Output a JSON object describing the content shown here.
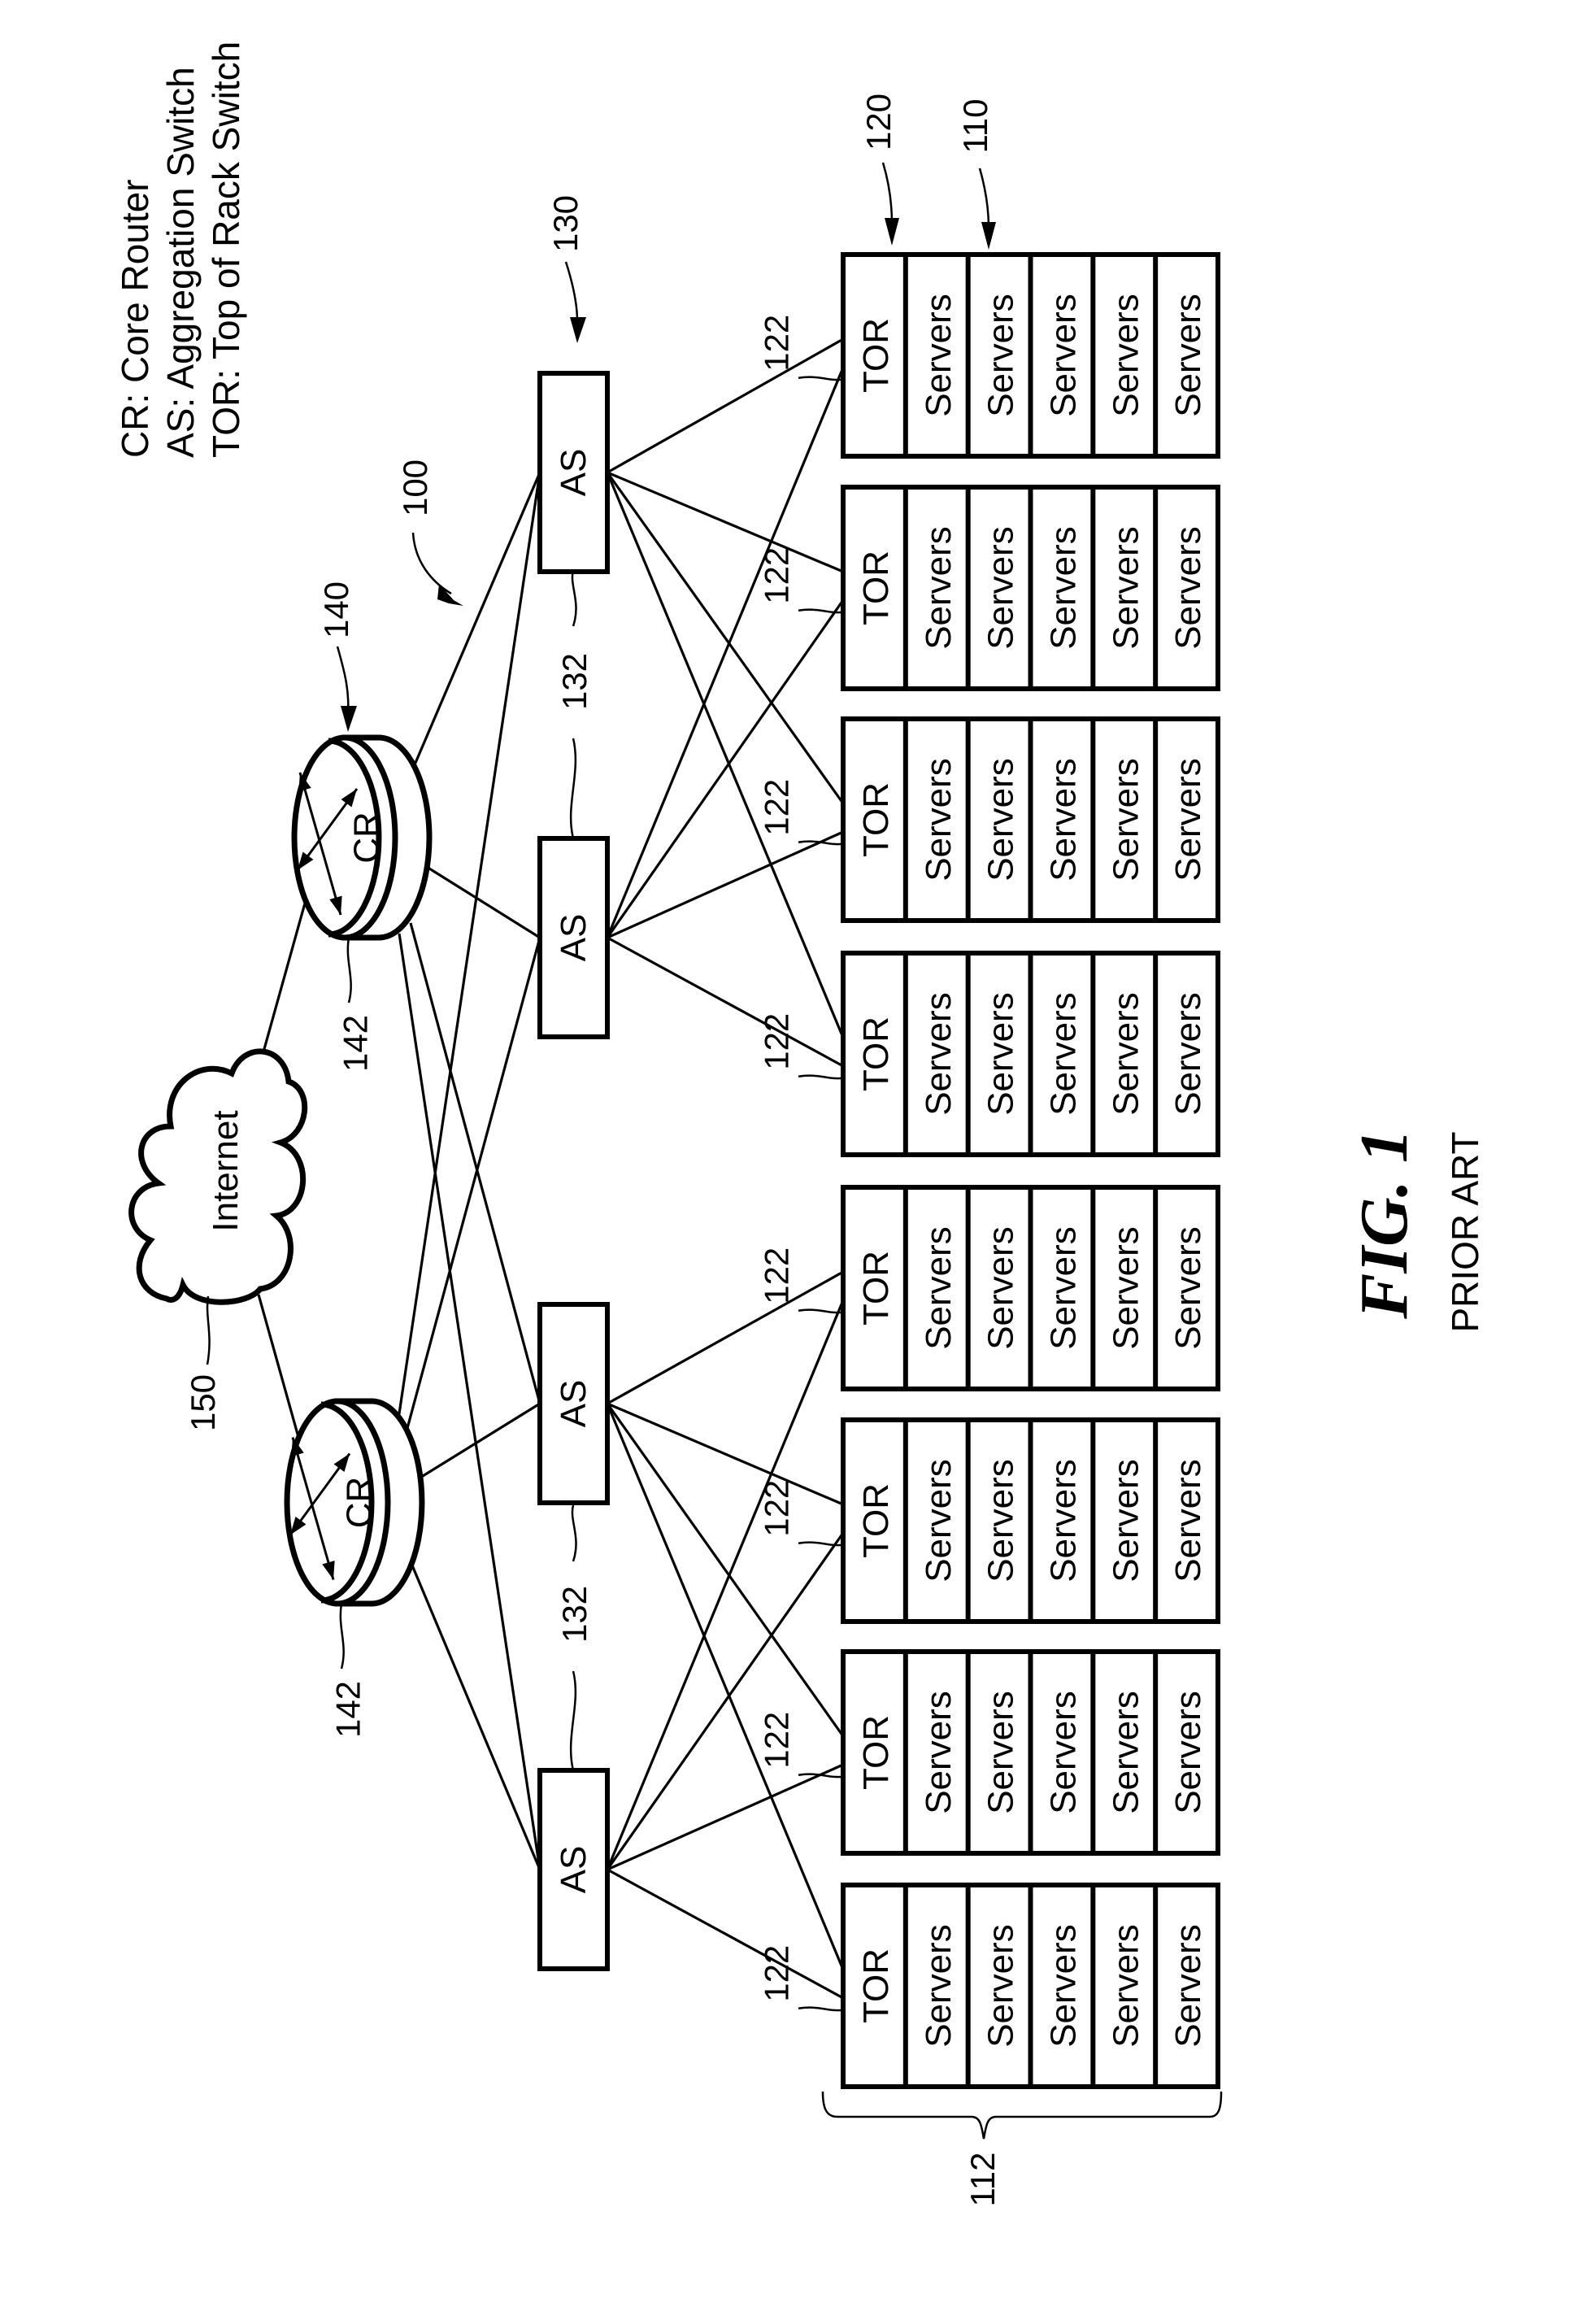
{
  "legend": [
    "CR: Core Router",
    "AS: Aggregation Switch",
    "TOR: Top of Rack Switch"
  ],
  "figure": {
    "title": "FIG. 1",
    "subtitle": "PRIOR ART"
  },
  "internet": {
    "label": "Internet",
    "ref": "150"
  },
  "core_routers": {
    "label": "CR",
    "group_ref": "140",
    "item_ref": "142",
    "count": 2
  },
  "aggregation_switches": {
    "label": "AS",
    "group_ref": "130",
    "item_ref": "132",
    "count": 4
  },
  "racks": {
    "tor_label": "TOR",
    "server_label": "Servers",
    "servers_per_rack": 5,
    "count": 8,
    "tor_group_ref": "120",
    "server_group_ref": "110",
    "tor_item_ref": "122",
    "rack_group_ref": "112"
  },
  "network_ref": "100",
  "connections": {
    "internet_to_cr": [
      1,
      2
    ],
    "cr_to_as": "all",
    "as_to_tor": [
      [
        1,
        2,
        3,
        4
      ],
      [
        1,
        2,
        3,
        4
      ],
      [
        5,
        6,
        7,
        8
      ],
      [
        5,
        6,
        7,
        8
      ]
    ]
  }
}
